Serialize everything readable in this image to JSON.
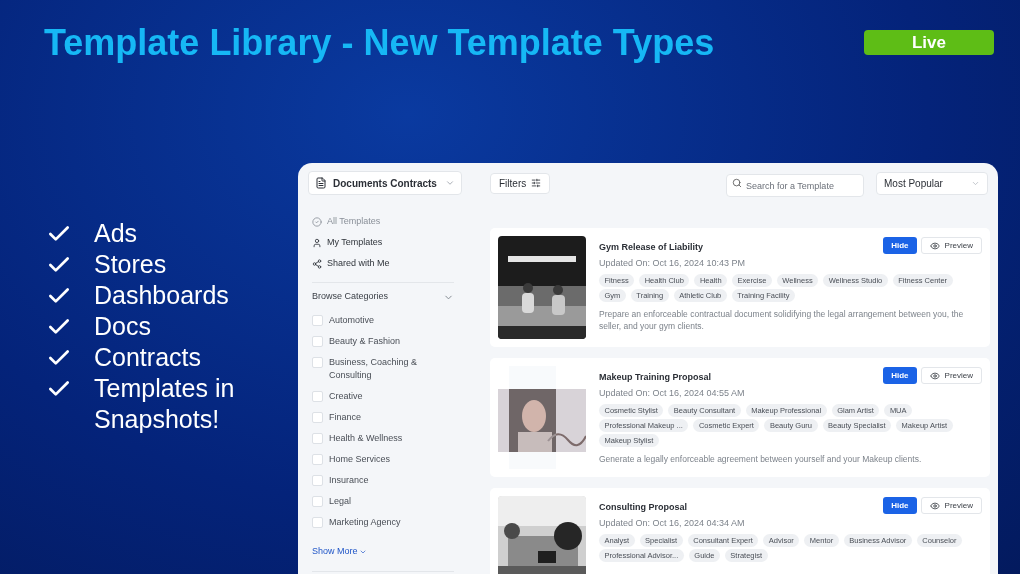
{
  "slide": {
    "title": "Template Library - New Template Types",
    "badge": "Live",
    "checklist": [
      "Ads",
      "Stores",
      "Dashboards",
      "Docs",
      "Contracts",
      "Templates in Snapshots!"
    ]
  },
  "app": {
    "category_dropdown": "Documents Contracts",
    "filters_button": "Filters",
    "search": {
      "placeholder": "Search for a Template"
    },
    "sort": "Most Popular",
    "nav": [
      {
        "label": "All Templates",
        "kind": "all",
        "selected": true
      },
      {
        "label": "My Templates",
        "kind": "mine",
        "selected": false
      },
      {
        "label": "Shared with Me",
        "kind": "shared",
        "selected": false
      }
    ],
    "browse_categories": {
      "title": "Browse Categories",
      "expanded": true,
      "items": [
        {
          "label": "Automotive",
          "checked": false
        },
        {
          "label": "Beauty & Fashion",
          "checked": false
        },
        {
          "label": "Business, Coaching & Consulting",
          "checked": false
        },
        {
          "label": "Creative",
          "checked": false
        },
        {
          "label": "Finance",
          "checked": false
        },
        {
          "label": "Health & Wellness",
          "checked": false
        },
        {
          "label": "Home Services",
          "checked": false
        },
        {
          "label": "Insurance",
          "checked": false
        },
        {
          "label": "Legal",
          "checked": false
        },
        {
          "label": "Marketing Agency",
          "checked": false
        }
      ],
      "show_more": "Show More"
    },
    "templates": [
      {
        "thumbnail": {
          "kind": "picture"
        },
        "title": "Gym Release of Liability",
        "updated": "Updated On: Oct 16, 2024 10:43 PM",
        "tags": [
          "Fitness",
          "Health Club",
          "Health",
          "Exercise",
          "Wellness",
          "Wellness Studio",
          "Fitness Center",
          "Gym",
          "Training",
          "Athletic Club",
          "Training Facility"
        ],
        "description": "Prepare an enforceable contractual document solidifying the legal arrangement between you, the seller, and your gym clients.",
        "hide": "Hide",
        "preview": "Preview"
      },
      {
        "thumbnail": {
          "kind": "picture"
        },
        "title": "Makeup Training Proposal",
        "updated": "Updated On: Oct 16, 2024 04:55 AM",
        "tags": [
          "Cosmetic Stylist",
          "Beauty Consultant",
          "Makeup Professional",
          "Glam Artist",
          "MUA",
          "Professional Makeup ...",
          "Cosmetic Expert",
          "Beauty Guru",
          "Beauty Specialist",
          "Makeup Artist",
          "Makeup Stylist"
        ],
        "description": "Generate a legally enforceable agreement between yourself and your Makeup clients.",
        "hide": "Hide",
        "preview": "Preview"
      },
      {
        "thumbnail": {
          "kind": "picture"
        },
        "title": "Consulting Proposal",
        "updated": "Updated On: Oct 16, 2024 04:34 AM",
        "tags": [
          "Analyst",
          "Specialist",
          "Consultant Expert",
          "Advisor",
          "Mentor",
          "Business Advisor",
          "Counselor",
          "Professional Advisor...",
          "Guide",
          "Strategist"
        ],
        "hide": "Hide",
        "preview": "Preview"
      }
    ]
  }
}
